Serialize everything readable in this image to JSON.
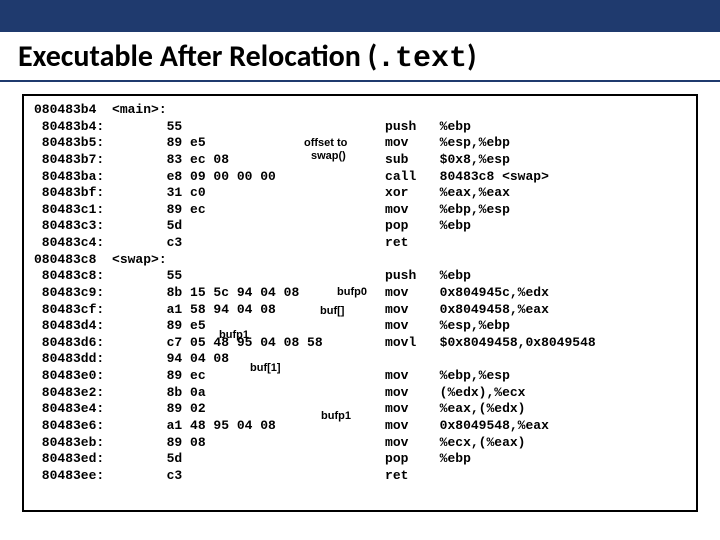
{
  "title_prefix": "Executable After Relocation (",
  "title_mono": ".text",
  "title_suffix": ")",
  "annotations": {
    "offset_to": "offset to",
    "swap_call": "swap()",
    "bufp0": "bufp0",
    "buf_arr": "buf[]",
    "bufp1a": "bufp1",
    "buf_1": "buf[1]",
    "bufp1b": "bufp1"
  },
  "lines": [
    {
      "a": "080483b4",
      "l": "<main>:",
      "b": "",
      "m": "",
      "o": ""
    },
    {
      "a": " 80483b4:",
      "l": "",
      "b": "55",
      "m": "push",
      "o": "%ebp"
    },
    {
      "a": " 80483b5:",
      "l": "",
      "b": "89 e5",
      "m": "mov",
      "o": "%esp,%ebp"
    },
    {
      "a": " 80483b7:",
      "l": "",
      "b": "83 ec 08",
      "m": "sub",
      "o": "$0x8,%esp"
    },
    {
      "a": " 80483ba:",
      "l": "",
      "b": "e8 09 00 00 00",
      "m": "call",
      "o": "80483c8 <swap>"
    },
    {
      "a": " 80483bf:",
      "l": "",
      "b": "31 c0",
      "m": "xor",
      "o": "%eax,%eax"
    },
    {
      "a": " 80483c1:",
      "l": "",
      "b": "89 ec",
      "m": "mov",
      "o": "%ebp,%esp"
    },
    {
      "a": " 80483c3:",
      "l": "",
      "b": "5d",
      "m": "pop",
      "o": "%ebp"
    },
    {
      "a": " 80483c4:",
      "l": "",
      "b": "c3",
      "m": "ret",
      "o": ""
    },
    {
      "a": "080483c8",
      "l": "<swap>:",
      "b": "",
      "m": "",
      "o": ""
    },
    {
      "a": " 80483c8:",
      "l": "",
      "b": "55",
      "m": "push",
      "o": "%ebp"
    },
    {
      "a": " 80483c9:",
      "l": "",
      "b": "8b 15 5c 94 04 08",
      "m": "mov",
      "o": "0x804945c,%edx"
    },
    {
      "a": " 80483cf:",
      "l": "",
      "b": "a1 58 94 04 08",
      "m": "mov",
      "o": "0x8049458,%eax"
    },
    {
      "a": " 80483d4:",
      "l": "",
      "b": "89 e5",
      "m": "mov",
      "o": "%esp,%ebp"
    },
    {
      "a": " 80483d6:",
      "l": "",
      "b": "c7 05 48 95 04 08 58",
      "m": "movl",
      "o": "$0x8049458,0x8049548"
    },
    {
      "a": " 80483dd:",
      "l": "",
      "b": "94 04 08",
      "m": "",
      "o": ""
    },
    {
      "a": " 80483e0:",
      "l": "",
      "b": "89 ec",
      "m": "mov",
      "o": "%ebp,%esp"
    },
    {
      "a": " 80483e2:",
      "l": "",
      "b": "8b 0a",
      "m": "mov",
      "o": "(%edx),%ecx"
    },
    {
      "a": " 80483e4:",
      "l": "",
      "b": "89 02",
      "m": "mov",
      "o": "%eax,(%edx)"
    },
    {
      "a": " 80483e6:",
      "l": "",
      "b": "a1 48 95 04 08",
      "m": "mov",
      "o": "0x8049548,%eax"
    },
    {
      "a": " 80483eb:",
      "l": "",
      "b": "89 08",
      "m": "mov",
      "o": "%ecx,(%eax)"
    },
    {
      "a": " 80483ed:",
      "l": "",
      "b": "5d",
      "m": "pop",
      "o": "%ebp"
    },
    {
      "a": " 80483ee:",
      "l": "",
      "b": "c3",
      "m": "ret",
      "o": ""
    }
  ]
}
